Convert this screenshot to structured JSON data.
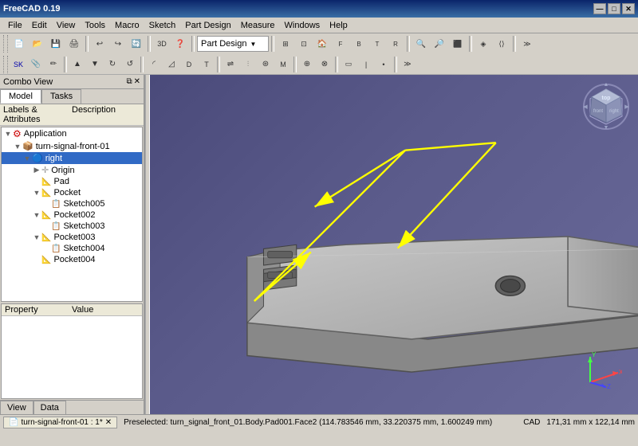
{
  "window": {
    "title": "FreeCAD 0.19",
    "min_label": "—",
    "max_label": "□",
    "close_label": "✕"
  },
  "menu": {
    "items": [
      "File",
      "Edit",
      "View",
      "Tools",
      "Macro",
      "Sketch",
      "Part Design",
      "Measure",
      "Windows",
      "Help"
    ]
  },
  "toolbar": {
    "dropdown_label": "Part Design",
    "dropdown_arrow": "▼"
  },
  "combo_view": {
    "title": "Combo View",
    "tabs": [
      "Model",
      "Tasks"
    ],
    "section": {
      "col1": "Labels & Attributes",
      "col2": "Description"
    }
  },
  "tree": {
    "items": [
      {
        "id": "app",
        "label": "Application",
        "level": 0,
        "expand": "",
        "icon": "🔧",
        "type": "root"
      },
      {
        "id": "body",
        "label": "turn-signal-front-01",
        "level": 1,
        "expand": "▼",
        "icon": "📦",
        "type": "body"
      },
      {
        "id": "right",
        "label": "right",
        "level": 2,
        "expand": "▼",
        "icon": "🔵",
        "type": "active",
        "selected": true
      },
      {
        "id": "origin",
        "label": "Origin",
        "level": 3,
        "expand": "▶",
        "icon": "✛",
        "type": "origin"
      },
      {
        "id": "pad",
        "label": "Pad",
        "level": 3,
        "expand": "",
        "icon": "📐",
        "type": "feature"
      },
      {
        "id": "pocket",
        "label": "Pocket",
        "level": 3,
        "expand": "▼",
        "icon": "📐",
        "type": "feature"
      },
      {
        "id": "sketch005",
        "label": "Sketch005",
        "level": 4,
        "expand": "",
        "icon": "📋",
        "type": "sketch"
      },
      {
        "id": "pocket002",
        "label": "Pocket002",
        "level": 3,
        "expand": "▼",
        "icon": "📐",
        "type": "feature"
      },
      {
        "id": "sketch003",
        "label": "Sketch003",
        "level": 4,
        "expand": "",
        "icon": "📋",
        "type": "sketch"
      },
      {
        "id": "pocket003",
        "label": "Pocket003",
        "level": 3,
        "expand": "▼",
        "icon": "📐",
        "type": "feature"
      },
      {
        "id": "sketch004",
        "label": "Sketch004",
        "level": 4,
        "expand": "",
        "icon": "📋",
        "type": "sketch"
      },
      {
        "id": "pocket004",
        "label": "Pocket004",
        "level": 3,
        "expand": "",
        "icon": "📐",
        "type": "feature"
      }
    ]
  },
  "properties": {
    "col1": "Property",
    "col2": "Value"
  },
  "bottom_tabs": [
    "View",
    "Data"
  ],
  "status": {
    "preselect": "Preselected: turn_signal_front_01.Body.Pad001.Face2 (114.783546 mm, 33.220375 mm, 1.600249 mm)",
    "file_tab": "turn-signal-front-01 : 1*",
    "file_icon": "📄",
    "cad_label": "CAD",
    "dimensions": "171,31 mm x 122,14 mm"
  },
  "colors": {
    "viewport_bg_start": "#4a4a7a",
    "viewport_bg_end": "#6a6a9a",
    "selection_blue": "#316ac5",
    "arrow_yellow": "#ffff00",
    "part_fill": "#a0a0a0",
    "part_stroke": "#505050"
  },
  "icons": {
    "gear": "⚙",
    "folder": "📁",
    "new": "📄",
    "save": "💾",
    "undo": "↩",
    "redo": "↪",
    "zoom_in": "🔍",
    "zoom_out": "🔎"
  }
}
